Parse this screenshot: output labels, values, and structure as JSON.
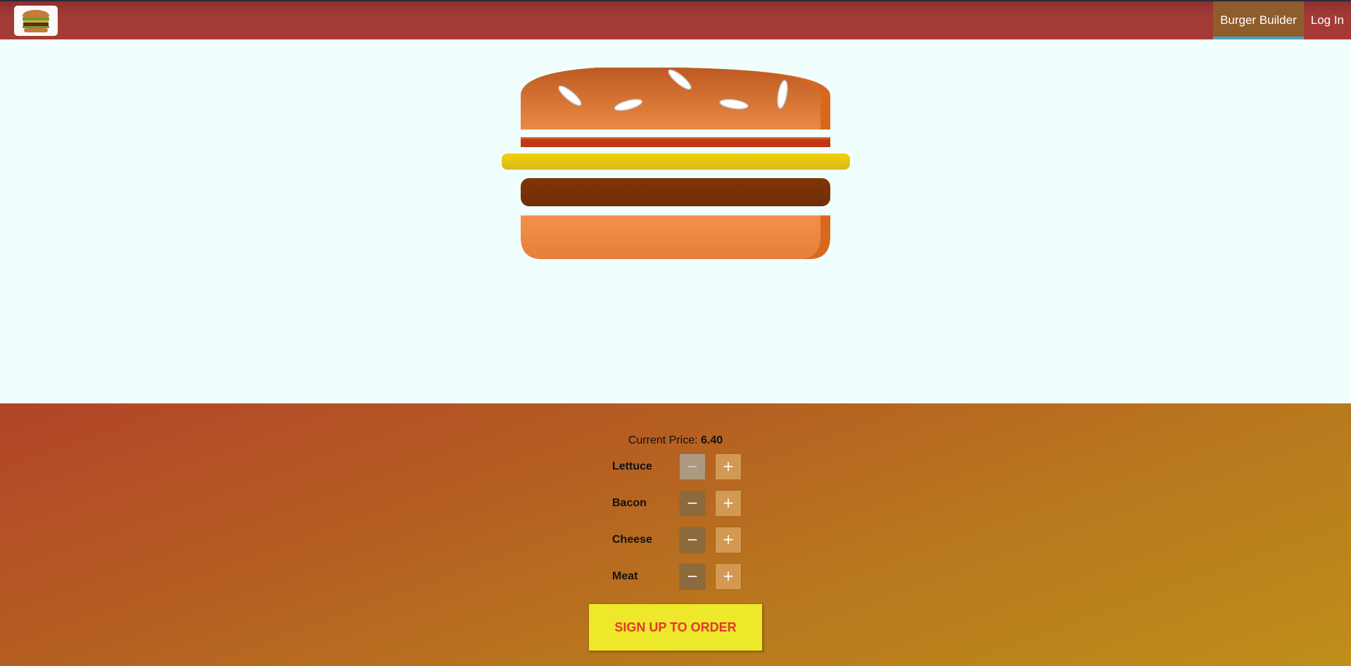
{
  "nav": {
    "logo_icon": "burger-logo-icon",
    "items": [
      {
        "label": "Burger Builder",
        "active": true
      },
      {
        "label": "Log In",
        "active": false
      }
    ]
  },
  "burger": {
    "layers": [
      "bread-top",
      "bacon",
      "cheese",
      "meat",
      "bread-bottom"
    ]
  },
  "controls": {
    "price_label": "Current Price:",
    "price_value": "6.40",
    "ingredients": [
      {
        "label": "Lettuce",
        "less": "−",
        "more": "+",
        "less_disabled": true
      },
      {
        "label": "Bacon",
        "less": "−",
        "more": "+",
        "less_disabled": false
      },
      {
        "label": "Cheese",
        "less": "−",
        "more": "+",
        "less_disabled": false
      },
      {
        "label": "Meat",
        "less": "−",
        "more": "+",
        "less_disabled": false
      }
    ],
    "order_button": "SIGN UP TO ORDER"
  },
  "colors": {
    "toolbar": "#a63a35",
    "active_nav": "#8f5c2c",
    "order_button_bg": "#eee82b",
    "order_button_text": "#e0392b"
  }
}
